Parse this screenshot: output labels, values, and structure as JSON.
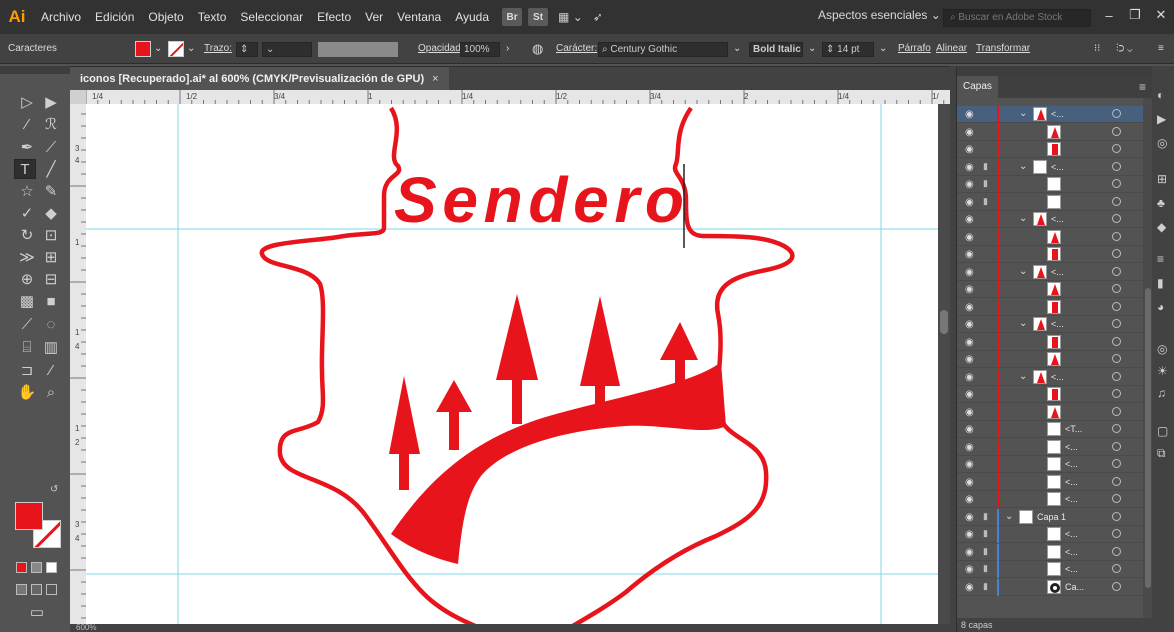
{
  "menubar": {
    "app_logo": "Ai",
    "items": [
      "Archivo",
      "Edición",
      "Objeto",
      "Texto",
      "Seleccionar",
      "Efecto",
      "Ver",
      "Ventana",
      "Ayuda"
    ],
    "bridge": "Br",
    "stock": "St",
    "workspace": "Aspectos esenciales  ⌄",
    "search_placeholder": "Buscar en Adobe Stock"
  },
  "controlbar": {
    "panel_label": "Caracteres",
    "stroke_label": "Trazo:",
    "opacity_label": "Opacidad:",
    "opacity_value": "100%",
    "character_label": "Carácter:",
    "font_family": "Century Gothic",
    "font_style": "Bold Italic",
    "font_size": "14 pt",
    "paragraph": "Párrafo",
    "align": "Alinear",
    "transform": "Transformar"
  },
  "document": {
    "tab_title": "iconos [Recuperado].ai* al 600% (CMYK/Previsualización de GPU)",
    "close": "×",
    "zoom": "600%",
    "artwork_text": "Sendero",
    "art_color": "#e8141c"
  },
  "ruler": {
    "h_labels": [
      "1/4",
      "1/2",
      "3/4",
      "1",
      "1/4",
      "1/2",
      "3/4",
      "2",
      "1/4",
      "1/"
    ],
    "v_labels": [
      "3",
      "4",
      "1",
      "1",
      "4",
      "1",
      "2",
      "3",
      "4"
    ]
  },
  "layers": {
    "tab": "Capas",
    "footer": "8 capas",
    "rows": [
      {
        "name": "<...",
        "indent": 1,
        "chevron": true,
        "thumb": "tree",
        "active": true,
        "lock": false,
        "color": "#e8141c"
      },
      {
        "name": "",
        "indent": 2,
        "chevron": false,
        "thumb": "tree",
        "active": false,
        "lock": false,
        "color": "#e8141c"
      },
      {
        "name": "",
        "indent": 2,
        "chevron": false,
        "thumb": "trunk",
        "active": false,
        "lock": false,
        "color": "#e8141c"
      },
      {
        "name": "<...",
        "indent": 1,
        "chevron": true,
        "thumb": "blank",
        "active": false,
        "lock": true,
        "color": "#e8141c"
      },
      {
        "name": "",
        "indent": 2,
        "chevron": false,
        "thumb": "blank",
        "active": false,
        "lock": true,
        "color": "#e8141c"
      },
      {
        "name": "",
        "indent": 2,
        "chevron": false,
        "thumb": "blank",
        "active": false,
        "lock": true,
        "color": "#e8141c"
      },
      {
        "name": "<...",
        "indent": 1,
        "chevron": true,
        "thumb": "tree",
        "active": false,
        "lock": false,
        "color": "#e8141c"
      },
      {
        "name": "",
        "indent": 2,
        "chevron": false,
        "thumb": "tree",
        "active": false,
        "lock": false,
        "color": "#e8141c"
      },
      {
        "name": "",
        "indent": 2,
        "chevron": false,
        "thumb": "trunk",
        "active": false,
        "lock": false,
        "color": "#e8141c"
      },
      {
        "name": "<...",
        "indent": 1,
        "chevron": true,
        "thumb": "tree",
        "active": false,
        "lock": false,
        "color": "#e8141c"
      },
      {
        "name": "",
        "indent": 2,
        "chevron": false,
        "thumb": "tree",
        "active": false,
        "lock": false,
        "color": "#e8141c"
      },
      {
        "name": "",
        "indent": 2,
        "chevron": false,
        "thumb": "trunk",
        "active": false,
        "lock": false,
        "color": "#e8141c"
      },
      {
        "name": "<...",
        "indent": 1,
        "chevron": true,
        "thumb": "tree",
        "active": false,
        "lock": false,
        "color": "#e8141c"
      },
      {
        "name": "",
        "indent": 2,
        "chevron": false,
        "thumb": "trunk",
        "active": false,
        "lock": false,
        "color": "#e8141c"
      },
      {
        "name": "",
        "indent": 2,
        "chevron": false,
        "thumb": "tree",
        "active": false,
        "lock": false,
        "color": "#e8141c"
      },
      {
        "name": "<...",
        "indent": 1,
        "chevron": true,
        "thumb": "tree",
        "active": false,
        "lock": false,
        "color": "#e8141c"
      },
      {
        "name": "",
        "indent": 2,
        "chevron": false,
        "thumb": "trunk",
        "active": false,
        "lock": false,
        "color": "#e8141c"
      },
      {
        "name": "",
        "indent": 2,
        "chevron": false,
        "thumb": "tree",
        "active": false,
        "lock": false,
        "color": "#e8141c"
      },
      {
        "name": "<T...",
        "indent": 2,
        "chevron": false,
        "thumb": "blank",
        "active": false,
        "lock": false,
        "color": "#e8141c"
      },
      {
        "name": "<...",
        "indent": 2,
        "chevron": false,
        "thumb": "blank",
        "active": false,
        "lock": false,
        "color": "#e8141c"
      },
      {
        "name": "<...",
        "indent": 2,
        "chevron": false,
        "thumb": "blank",
        "active": false,
        "lock": false,
        "color": "#e8141c"
      },
      {
        "name": "<...",
        "indent": 2,
        "chevron": false,
        "thumb": "blank",
        "active": false,
        "lock": false,
        "color": "#e8141c"
      },
      {
        "name": "<...",
        "indent": 2,
        "chevron": false,
        "thumb": "blank",
        "active": false,
        "lock": false,
        "color": "#e8141c"
      },
      {
        "name": "Capa 1",
        "indent": 0,
        "chevron": true,
        "thumb": "blank",
        "active": false,
        "lock": true,
        "color": "#4a7fd6"
      },
      {
        "name": "<...",
        "indent": 2,
        "chevron": false,
        "thumb": "blank",
        "active": false,
        "lock": true,
        "color": "#4a7fd6"
      },
      {
        "name": "<...",
        "indent": 2,
        "chevron": false,
        "thumb": "blank",
        "active": false,
        "lock": true,
        "color": "#4a7fd6"
      },
      {
        "name": "<...",
        "indent": 2,
        "chevron": false,
        "thumb": "blank",
        "active": false,
        "lock": true,
        "color": "#4a7fd6"
      },
      {
        "name": "Ca...",
        "indent": 2,
        "chevron": false,
        "thumb": "gear",
        "active": false,
        "lock": true,
        "color": "#4a7fd6"
      }
    ]
  },
  "colors": {
    "fill": "#e8141c",
    "guide": "#7fd8e8"
  }
}
